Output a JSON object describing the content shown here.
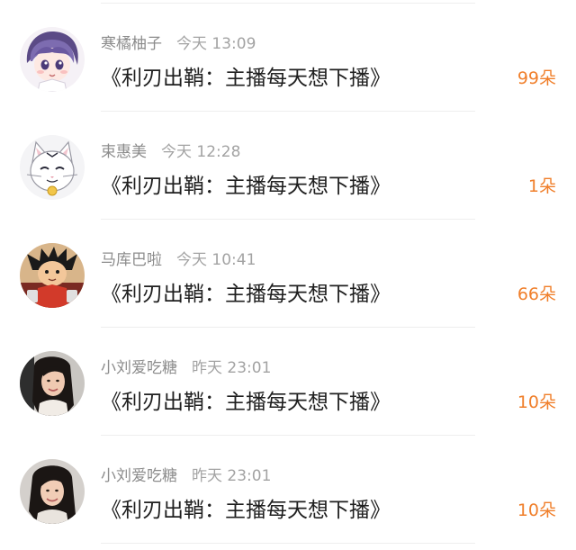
{
  "items": [
    {
      "user": "寒橘柚子",
      "time": "今天 13:09",
      "title": "《利刃出鞘：主播每天想下播》",
      "count": "99朵",
      "avatar": "anime-girl-avatar-icon"
    },
    {
      "user": "束惠美",
      "time": "今天 12:28",
      "title": "《利刃出鞘：主播每天想下播》",
      "count": "1朵",
      "avatar": "white-cat-avatar-icon"
    },
    {
      "user": "马库巴啦",
      "time": "今天 10:41",
      "title": "《利刃出鞘：主播每天想下播》",
      "count": "66朵",
      "avatar": "cartoon-boy-avatar-icon"
    },
    {
      "user": "小刘爱吃糖",
      "time": "昨天 23:01",
      "title": "《利刃出鞘：主播每天想下播》",
      "count": "10朵",
      "avatar": "woman-photo-avatar-icon"
    },
    {
      "user": "小刘爱吃糖",
      "time": "昨天 23:01",
      "title": "《利刃出鞘：主播每天想下播》",
      "count": "10朵",
      "avatar": "woman-photo-avatar-icon"
    }
  ],
  "colors": {
    "accent": "#f07f2b",
    "title_text": "#1f1f1f",
    "meta_text": "#8c8c8c",
    "separator": "#eeeeee"
  }
}
